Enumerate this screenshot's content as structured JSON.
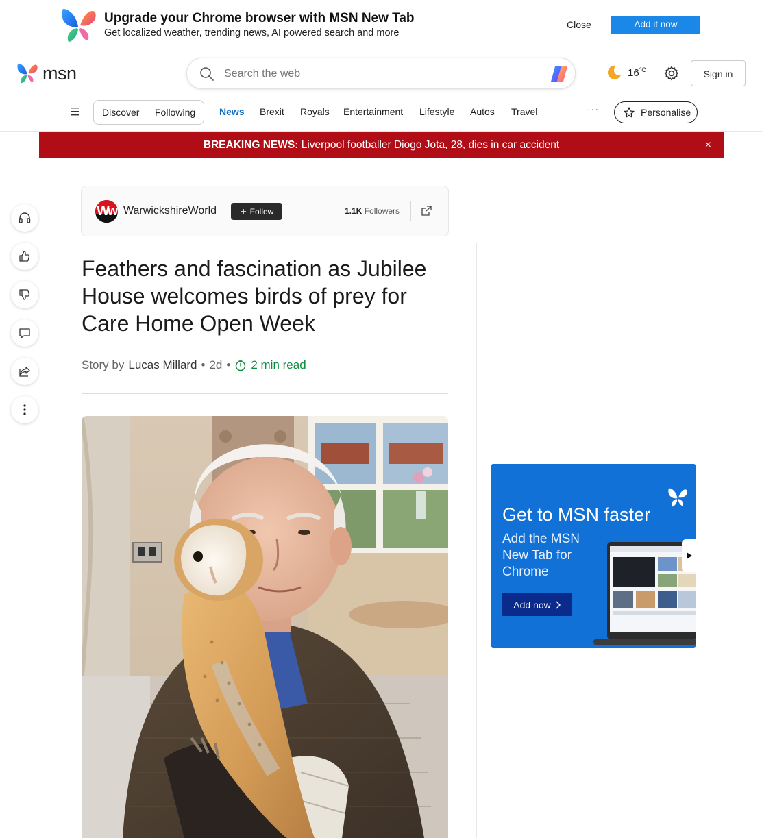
{
  "promo": {
    "title": "Upgrade your Chrome browser with MSN New Tab",
    "subtitle": "Get localized weather, trending news, AI powered search and more",
    "close_label": "Close",
    "add_label": "Add it now"
  },
  "header": {
    "logo_text": "msn",
    "search_placeholder": "Search the web",
    "temperature": "16",
    "temperature_unit": "°C",
    "signin_label": "Sign in"
  },
  "nav": {
    "pill_items": [
      "Discover",
      "Following"
    ],
    "items": [
      "News",
      "Brexit",
      "Royals",
      "Entertainment",
      "Lifestyle",
      "Autos",
      "Travel"
    ],
    "active": "News",
    "more_label": "···",
    "personalise_label": "Personalise"
  },
  "breaking": {
    "prefix": "BREAKING NEWS:",
    "text": "Liverpool footballer Diogo Jota, 28, dies in car accident",
    "close_label": "×"
  },
  "publisher": {
    "name": "WarwickshireWorld",
    "logo_letters": "Ww",
    "follow_label": "Follow",
    "followers_count": "1.1K",
    "followers_label": "Followers"
  },
  "article": {
    "headline": "Feathers and fascination as Jubilee House welcomes birds of prey for Care Home Open Week",
    "story_by": "Story by",
    "author": "Lucas Millard",
    "age": "2d",
    "read_time": "2 min read"
  },
  "ad": {
    "title": "Get to MSN faster",
    "subtitle": "Add the MSN New Tab for Chrome",
    "button_label": "Add now"
  },
  "colors": {
    "accent": "#0f6cbd",
    "breaking": "#b00d17",
    "promo_button": "#1b87e6",
    "read_time": "#0e8a3f",
    "ad_bg": "#1271d7"
  }
}
